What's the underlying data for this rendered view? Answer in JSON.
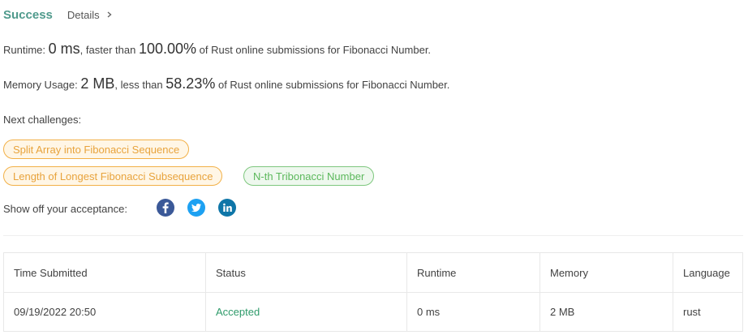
{
  "header": {
    "status": "Success",
    "details_label": "Details"
  },
  "runtime": {
    "label": "Runtime:",
    "value": "0 ms",
    "faster_than": ", faster than",
    "percent": "100.00%",
    "suffix": "of Rust online submissions for Fibonacci Number."
  },
  "memory": {
    "label": "Memory Usage:",
    "value": "2 MB",
    "less_than": ", less than",
    "percent": "58.23%",
    "suffix": "of Rust online submissions for Fibonacci Number."
  },
  "next_challenges": {
    "label": "Next challenges:",
    "items": [
      {
        "label": "Split Array into Fibonacci Sequence",
        "difficulty": "medium"
      },
      {
        "label": "Length of Longest Fibonacci Subsequence",
        "difficulty": "medium"
      },
      {
        "label": "N-th Tribonacci Number",
        "difficulty": "easy"
      }
    ]
  },
  "share": {
    "label": "Show off your acceptance:",
    "icons": [
      "facebook-icon",
      "twitter-icon",
      "linkedin-icon"
    ],
    "colors": {
      "facebook": "#3b5998",
      "twitter": "#1da1f2",
      "linkedin": "#0e76a8"
    }
  },
  "table": {
    "headers": [
      "Time Submitted",
      "Status",
      "Runtime",
      "Memory",
      "Language"
    ],
    "rows": [
      [
        "09/19/2022 20:50",
        "Accepted",
        "0 ms",
        "2 MB",
        "rust"
      ]
    ]
  },
  "colors": {
    "success": "#4f9a8c",
    "medium": "#e8a33c",
    "easy": "#5cb85c",
    "accepted": "#2f9b6b"
  }
}
